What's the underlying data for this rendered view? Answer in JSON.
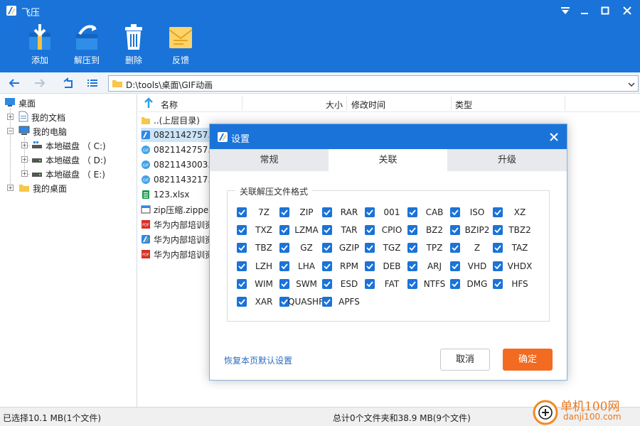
{
  "app": {
    "title": "飞压"
  },
  "toolbar": {
    "items": [
      {
        "label": "添加",
        "icon": "add-archive-icon"
      },
      {
        "label": "解压到",
        "icon": "extract-to-icon"
      },
      {
        "label": "删除",
        "icon": "trash-icon"
      },
      {
        "label": "反馈",
        "icon": "feedback-envelope-icon"
      }
    ]
  },
  "address": {
    "path": "D:\\tools\\桌面\\GIF动画"
  },
  "tree": {
    "items": [
      {
        "label": "桌面",
        "icon": "desktop-icon"
      },
      {
        "label": "我的文档",
        "icon": "document-icon"
      },
      {
        "label": "我的电脑",
        "icon": "computer-icon"
      },
      {
        "label": "本地磁盘 （ C:)",
        "icon": "drive-c-icon"
      },
      {
        "label": "本地磁盘 （ D:)",
        "icon": "drive-icon"
      },
      {
        "label": "本地磁盘 （ E:)",
        "icon": "drive-icon"
      },
      {
        "label": "我的桌面",
        "icon": "folder-icon"
      }
    ]
  },
  "filelist": {
    "columns": {
      "name": "名称",
      "size": "大小",
      "modified": "修改时间",
      "type": "类型"
    },
    "rows": [
      {
        "name": "..(上层目录)",
        "icon": "folder-icon"
      },
      {
        "name": "0821142757.7",
        "icon": "app-archive-icon"
      },
      {
        "name": "0821142757.g",
        "icon": "gif-icon"
      },
      {
        "name": "0821143003.g",
        "icon": "gif-icon"
      },
      {
        "name": "0821143217.g",
        "icon": "gif-icon"
      },
      {
        "name": "123.xlsx",
        "icon": "excel-icon"
      },
      {
        "name": "zip压缩.zippe",
        "icon": "zip-file-icon"
      },
      {
        "name": "华为内部培训资",
        "icon": "pdf-icon"
      },
      {
        "name": "华为内部培训资",
        "icon": "app-archive-icon"
      },
      {
        "name": "华为内部培训资",
        "icon": "pdf-icon"
      }
    ]
  },
  "status": {
    "left": "已选择10.1 MB(1个文件)",
    "middle": "总计0个文件夹和38.9 MB(9个文件)"
  },
  "watermark": {
    "line1": "单机100网",
    "line2": "danji100.com"
  },
  "dialog": {
    "title": "设置",
    "tabs": [
      {
        "label": "常规"
      },
      {
        "label": "关联"
      },
      {
        "label": "升级"
      }
    ],
    "active_tab": "关联",
    "group_label": "关联解压文件格式",
    "formats": [
      [
        "7Z",
        "ZIP",
        "RAR",
        "001",
        "CAB",
        "ISO",
        "XZ"
      ],
      [
        "TXZ",
        "LZMA",
        "TAR",
        "CPIO",
        "BZ2",
        "BZIP2",
        "TBZ2"
      ],
      [
        "TBZ",
        "GZ",
        "GZIP",
        "TGZ",
        "TPZ",
        "Z",
        "TAZ"
      ],
      [
        "LZH",
        "LHA",
        "RPM",
        "DEB",
        "ARJ",
        "VHD",
        "VHDX"
      ],
      [
        "WIM",
        "SWM",
        "ESD",
        "FAT",
        "NTFS",
        "DMG",
        "HFS"
      ],
      [
        "XAR",
        "QUASHFS",
        "APFS"
      ]
    ],
    "all_checked": true,
    "restore_label": "恢复本页默认设置",
    "cancel_label": "取消",
    "ok_label": "确定"
  },
  "colors": {
    "accent": "#1a73d8",
    "ok_button": "#f26b21",
    "link": "#2a6bbf"
  }
}
